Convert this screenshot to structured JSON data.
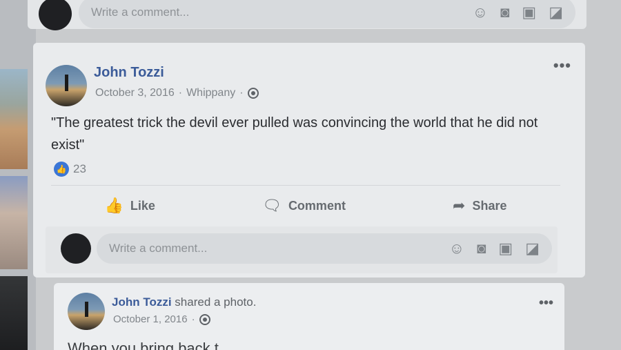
{
  "top_comment": {
    "placeholder": "Write a comment..."
  },
  "post": {
    "author": "John Tozzi",
    "date": "October 3, 2016",
    "location": "Whippany",
    "separator": "·",
    "more_label": "•••",
    "text": "\"The greatest trick the devil ever pulled was convincing the world that he did not exist\"",
    "reaction_count": "23",
    "actions": {
      "like": "Like",
      "comment": "Comment",
      "share": "Share"
    },
    "comment_placeholder": "Write a comment..."
  },
  "shared_post": {
    "author": "John Tozzi",
    "action_text": "shared a photo.",
    "date": "October 1, 2016",
    "more_label": "•••",
    "text_preview": "When you bring back t..."
  },
  "colors": {
    "accent": "#3b5b99",
    "like_blue": "#3b76d6"
  },
  "icons": [
    "emoji-icon",
    "camera-icon",
    "gif-icon",
    "sticker-icon",
    "globe-icon",
    "like-icon",
    "comment-icon",
    "share-icon"
  ]
}
